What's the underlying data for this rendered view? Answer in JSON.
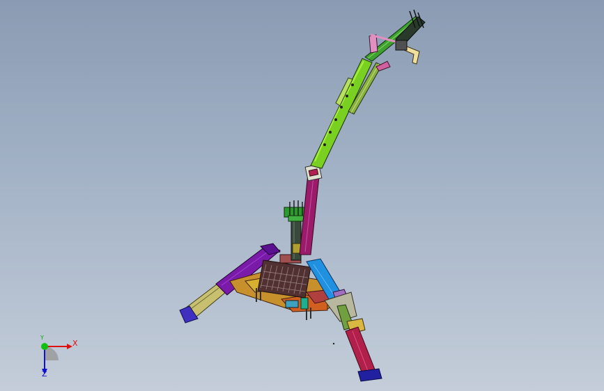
{
  "viewport": {
    "background_top": "#8a9bb3",
    "background_bottom": "#c4cdd9"
  },
  "triad": {
    "x_label": "X",
    "y_label": "Y",
    "z_label": "Z",
    "x_color": "#e01010",
    "y_color": "#10a010",
    "z_color": "#1010d0"
  },
  "model": {
    "parts": [
      "leg-left-outer",
      "leg-left-inner",
      "leg-right",
      "leg-lower-right",
      "base-frame",
      "engine-grille",
      "mast",
      "mast-head",
      "boom-main",
      "boom-upper",
      "jib",
      "jib-head",
      "hydraulic-cylinder"
    ],
    "colors": {
      "purple": "#7a1aa8",
      "olive": "#b8b860",
      "magenta": "#9b1b6b",
      "crimson": "#b0204a",
      "lime": "#7ad020",
      "green": "#2a9a2a",
      "blue": "#2090e0",
      "orange": "#d07020",
      "navy": "#2020a0",
      "dark": "#303030"
    }
  }
}
